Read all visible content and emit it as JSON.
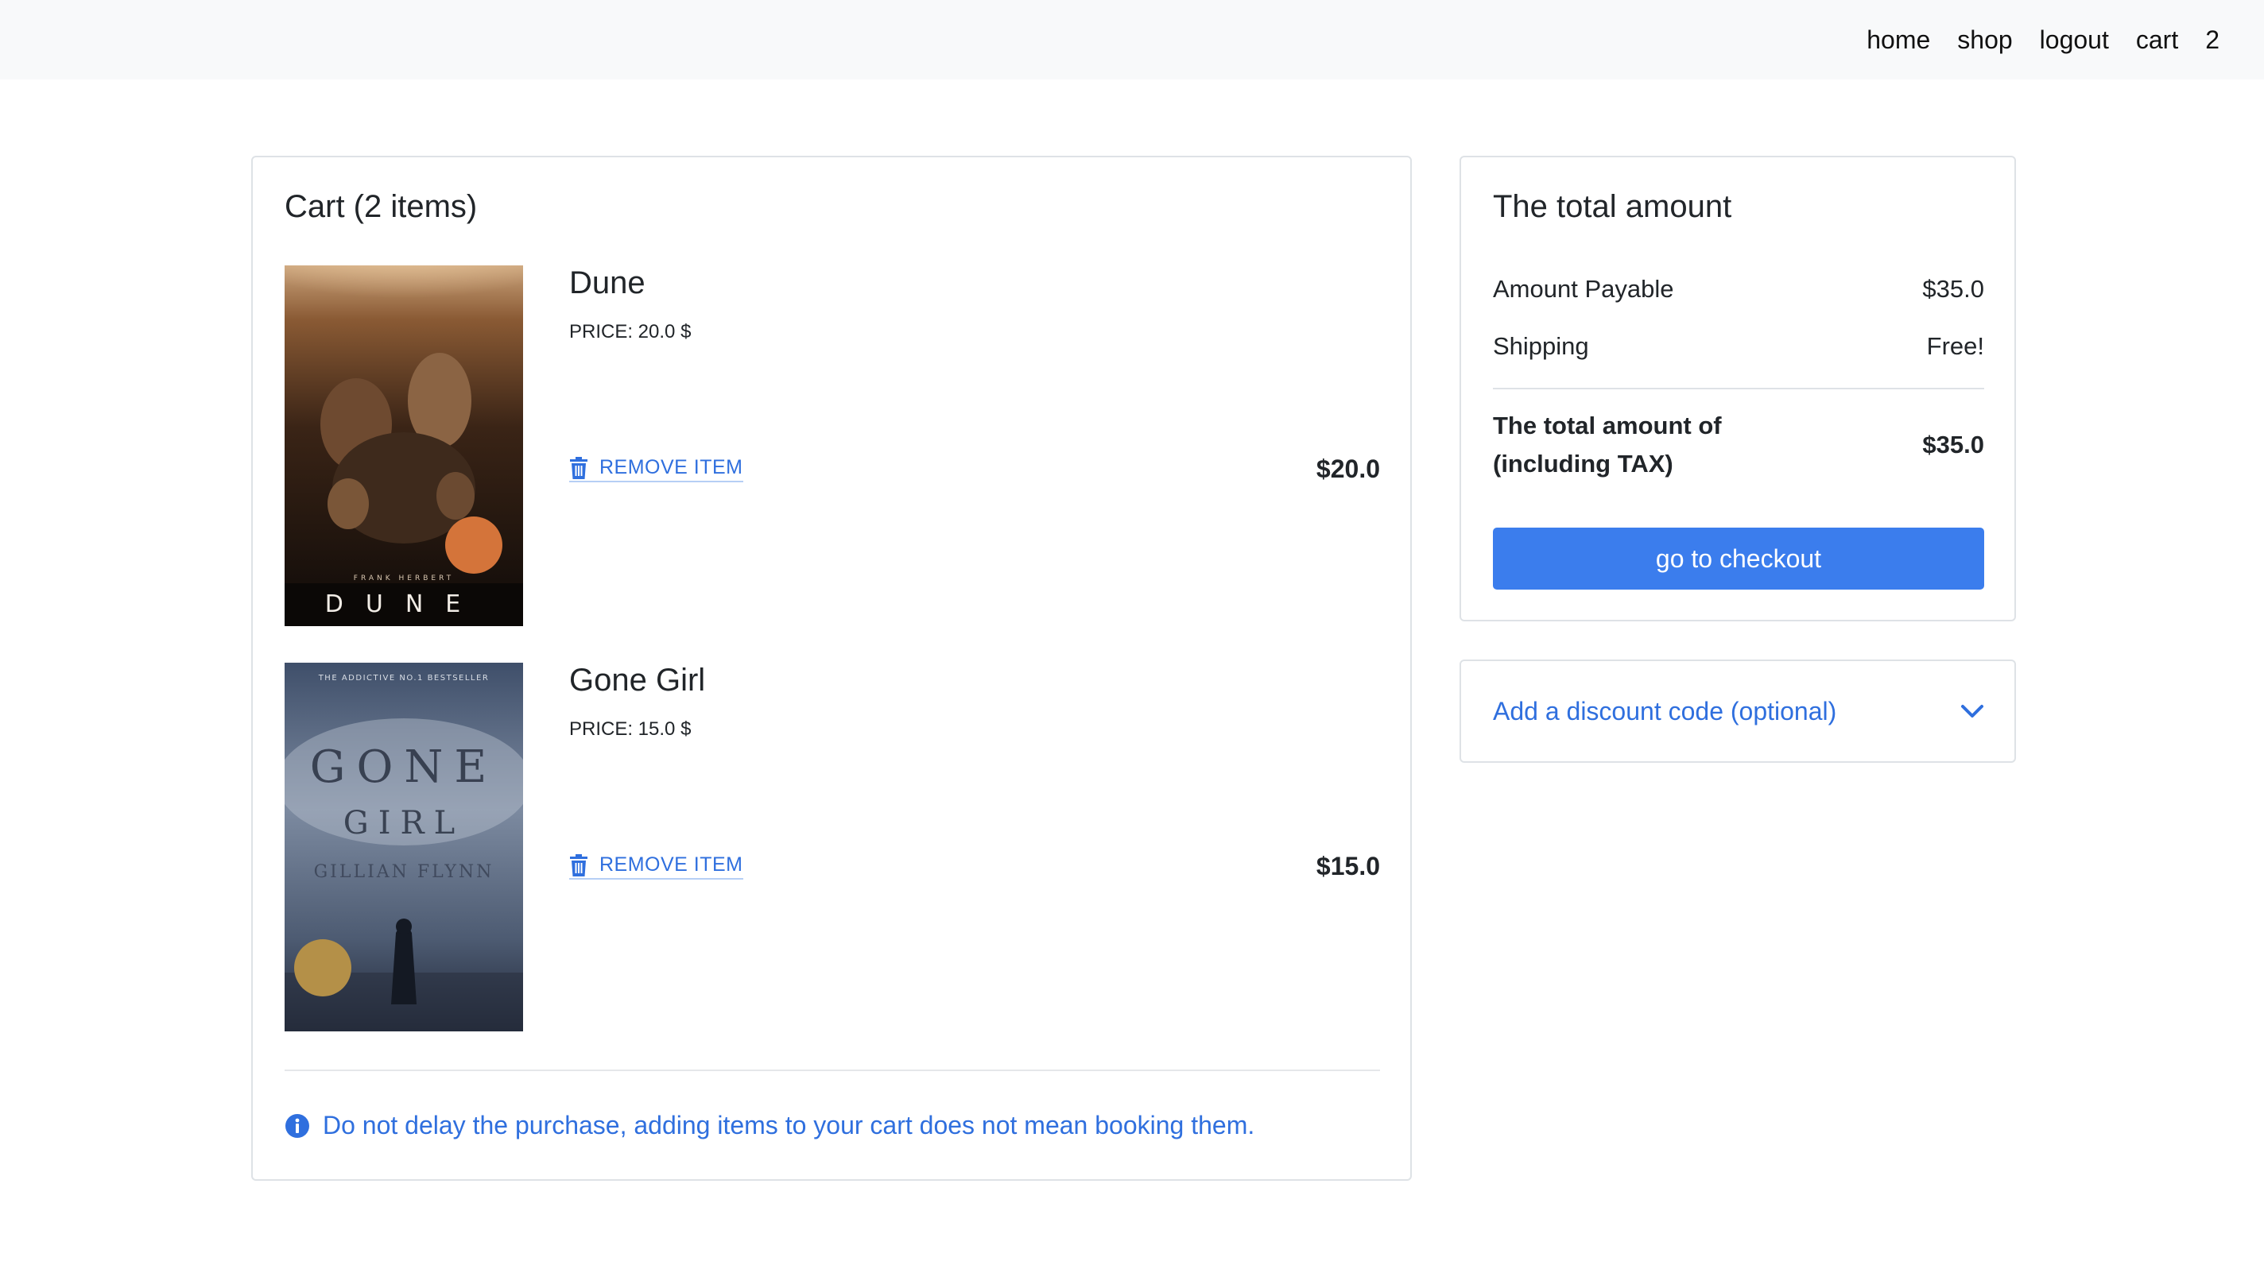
{
  "nav": {
    "home": "home",
    "shop": "shop",
    "logout": "logout",
    "cart": "cart",
    "cart_count": "2"
  },
  "cart": {
    "title": "Cart (2 items)",
    "items": [
      {
        "name": "Dune",
        "price_label": "PRICE: 20.0 $",
        "remove_label": "REMOVE ITEM",
        "total": "$20.0"
      },
      {
        "name": "Gone Girl",
        "price_label": "PRICE: 15.0 $",
        "remove_label": "REMOVE ITEM",
        "total": "$15.0"
      }
    ],
    "notice": "Do not delay the purchase, adding items to your cart does not mean booking them."
  },
  "summary": {
    "title": "The total amount",
    "payable_label": "Amount Payable",
    "payable_value": "$35.0",
    "shipping_label": "Shipping",
    "shipping_value": "Free!",
    "total_label": "The total amount of (including TAX)",
    "total_value": "$35.0",
    "checkout_label": "go to checkout"
  },
  "discount": {
    "label": "Add a discount code (optional)"
  },
  "colors": {
    "accent": "#3b7ded",
    "link": "#2f6fde",
    "navbar_bg": "#f8f9fa"
  }
}
